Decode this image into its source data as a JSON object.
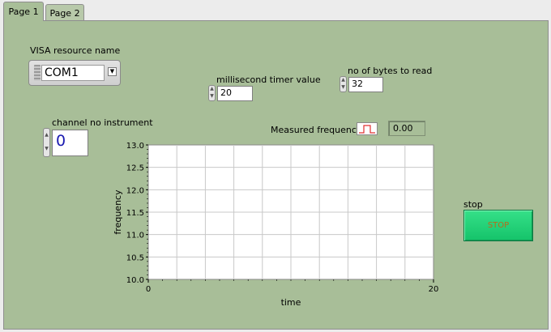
{
  "tabs": [
    {
      "label": "Page 1"
    },
    {
      "label": "Page 2"
    }
  ],
  "visa": {
    "label": "VISA resource name",
    "value": "COM1"
  },
  "timer": {
    "label": "millisecond timer value",
    "value": "20"
  },
  "bytes": {
    "label": "no of bytes to read",
    "value": "32"
  },
  "channel": {
    "label": "channel no instrument",
    "value": "0"
  },
  "measured": {
    "label": "Measured frequency",
    "value": "0.00",
    "icon": "square-wave-icon"
  },
  "stop": {
    "label": "stop",
    "button_text": "STOP"
  },
  "colors": {
    "panel": "#a8be98",
    "stop_button": "#1fd077",
    "wave": "#e03030"
  },
  "chart_data": {
    "type": "line",
    "xlabel": "time",
    "ylabel": "frequency",
    "xlim": [
      0,
      20
    ],
    "ylim": [
      10.0,
      13.0
    ],
    "x_ticks": [
      "0",
      "20"
    ],
    "y_ticks": [
      "10.0",
      "10.5",
      "11.0",
      "11.5",
      "12.0",
      "12.5",
      "13.0"
    ],
    "grid": true,
    "series": []
  }
}
